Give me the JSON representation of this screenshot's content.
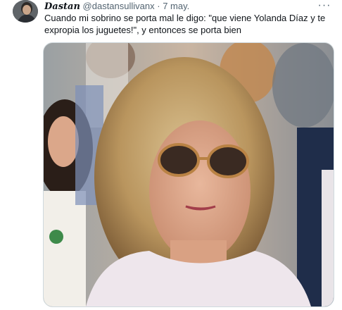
{
  "tweet": {
    "author": {
      "display_name": "Dastan",
      "handle": "@dastansullivanx",
      "separator": "·",
      "date": "7 may."
    },
    "text_lines": [
      "Cuando mi sobrino se porta mal le digo: \"que viene Yolanda Díaz y te",
      "expropia los juguetes!\", y entonces se porta bien"
    ],
    "more_icon": "more-horizontal-icon",
    "more_glyph": "···"
  }
}
